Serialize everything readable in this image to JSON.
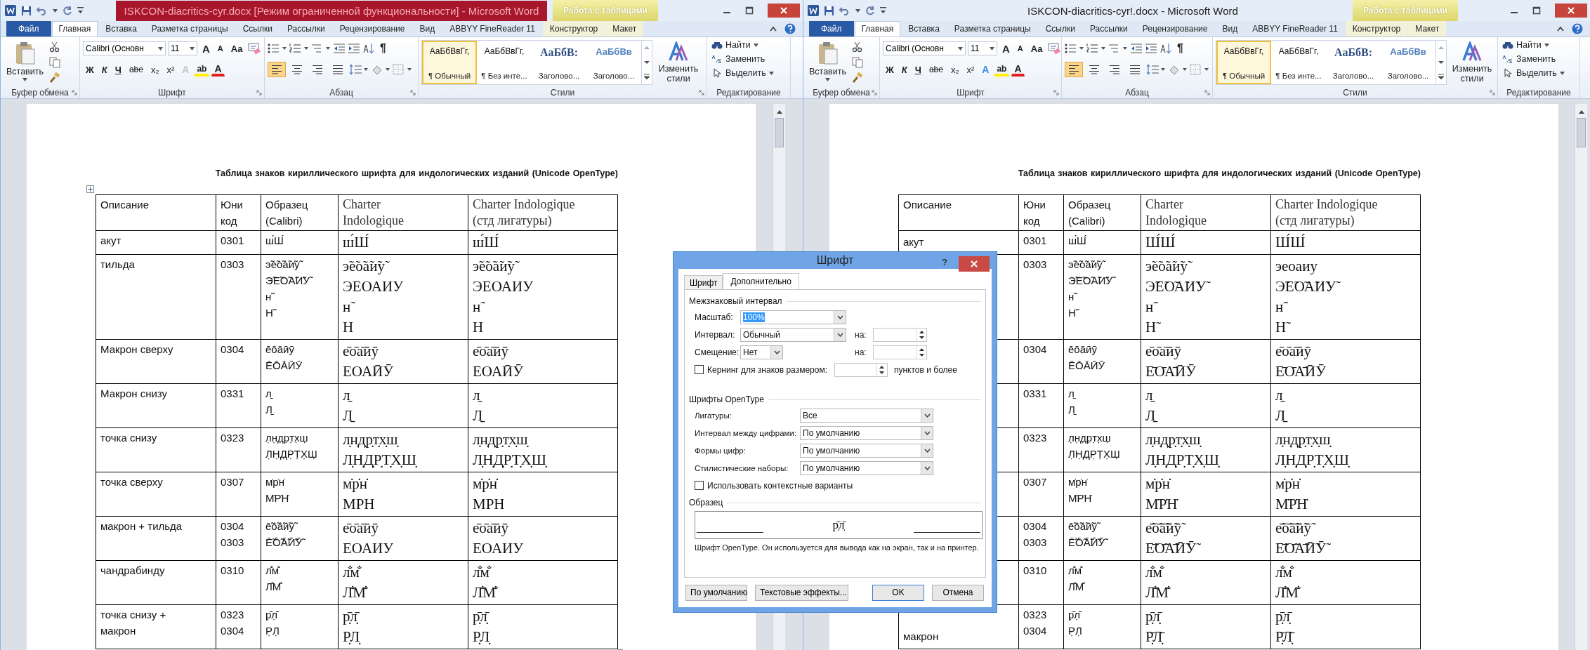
{
  "windows": [
    {
      "title": "ISKCON-diacritics-cyr.docx [Режим ограниченной функциональности] - Microsoft Word",
      "title_highlighted": true,
      "contextual_group": "Работа с таблицами",
      "tabs": [
        {
          "label": "Файл",
          "kind": "file",
          "selected": false
        },
        {
          "label": "Главная",
          "kind": "normal",
          "selected": true
        },
        {
          "label": "Вставка",
          "kind": "normal",
          "selected": false
        },
        {
          "label": "Разметка страницы",
          "kind": "normal",
          "selected": false
        },
        {
          "label": "Ссылки",
          "kind": "normal",
          "selected": false
        },
        {
          "label": "Рассылки",
          "kind": "normal",
          "selected": false
        },
        {
          "label": "Рецензирование",
          "kind": "normal",
          "selected": false
        },
        {
          "label": "Вид",
          "kind": "normal",
          "selected": false
        },
        {
          "label": "ABBYY FineReader 11",
          "kind": "normal",
          "selected": false
        },
        {
          "label": "Конструктор",
          "kind": "contextual",
          "selected": false
        },
        {
          "label": "Макет",
          "kind": "contextual",
          "selected": false
        }
      ],
      "ribbon": {
        "paste": "Вставить",
        "font_name": "Calibri (Основн",
        "font_size": "11",
        "font_tools": [
          {
            "label": "A",
            "kind": "grow"
          },
          {
            "label": "A",
            "kind": "shrink"
          },
          {
            "label": "Aa",
            "kind": "case"
          }
        ],
        "font_buttons": [
          {
            "label": "Ж",
            "kind": "bold"
          },
          {
            "label": "К",
            "kind": "italic"
          },
          {
            "label": "Ч",
            "kind": "underline"
          },
          {
            "label": "abe",
            "kind": "strike"
          },
          {
            "label": "x₂",
            "kind": "plain"
          },
          {
            "label": "x²",
            "kind": "plain"
          }
        ],
        "color_tools": [
          {
            "label": "A",
            "kind": "effects",
            "disabled": true
          },
          {
            "label": "ab",
            "kind": "highlight",
            "disabled": false
          },
          {
            "label": "A",
            "kind": "color",
            "disabled": false
          }
        ],
        "marks_button": "¶",
        "align_buttons": [
          {
            "kind": "left",
            "selected": true
          },
          {
            "kind": "center",
            "selected": false
          },
          {
            "kind": "right",
            "selected": false
          },
          {
            "kind": "justify",
            "selected": false
          }
        ],
        "styles": [
          {
            "sample": "АаБбВвГг,",
            "name": "¶ Обычный",
            "kind": "normal",
            "selected": true
          },
          {
            "sample": "АаБбВвГг,",
            "name": "¶ Без инте...",
            "kind": "plain",
            "selected": false
          },
          {
            "sample": "АаБбВ:",
            "name": "Заголово...",
            "kind": "heading1",
            "selected": false
          },
          {
            "sample": "АаБбВв",
            "name": "Заголово...",
            "kind": "heading2",
            "selected": false
          }
        ],
        "change_styles": "Изменить стили",
        "editing": [
          {
            "label": "Найти",
            "kind": "find"
          },
          {
            "label": "Заменить",
            "kind": "replace"
          },
          {
            "label": "Выделить",
            "kind": "select"
          }
        ],
        "group_labels": [
          "Буфер обмена",
          "Шрифт",
          "Абзац",
          "Стили",
          "Редактирование"
        ]
      },
      "document": {
        "heading": "Таблица знаков кириллического шрифта для индологических изданий (Unicode OpenType)",
        "table_handles": true,
        "columns": [
          {
            "label": "Описание",
            "kind": "sans"
          },
          {
            "label": "Юни\nкод",
            "kind": "sans"
          },
          {
            "label": "Образец\n(Calibri)",
            "kind": "sans"
          },
          {
            "label": "Charter\nIndologique",
            "kind": "serif"
          },
          {
            "label": "Charter Indologique\n(стд лигатуры)",
            "kind": "serif"
          }
        ],
        "rows": [
          {
            "cells": [
              "акут",
              "0301",
              "ш́Ш́",
              "ш́Ш́",
              "ш́Ш́"
            ]
          },
          {
            "cells": [
              "тильда",
              "0303",
              "э̃е̃о̃а̃и̃у̃\nЭ̃Е̃О̃А̃И̃У̃\nн̃\nН̃",
              "э̃е̃о̃а̃и̃у̃\nЭЕОАИУ\nн̃\nН",
              "э̃е̃о̃а̃и̃у̃\nЭЕОАИУ\nн̃\nН"
            ]
          },
          {
            "cells": [
              "Макрон сверху",
              "0304",
              "е̄о̄а̄ӣӯ\nЕ̄О̄А̄ӢӮ",
              "е̄о̄а̄ӣӯ\nЕОАӢӮ",
              "е̄о̄а̄ӣӯ\nЕОАӢӮ"
            ]
          },
          {
            "cells": [
              "Макрон снизу",
              "0331",
              "л̱\nЛ̱",
              "л̱\nЛ̱",
              "л̱\nЛ̱"
            ]
          },
          {
            "cells": [
              "точка снизу",
              "0323",
              "л̣н̣д̣р̣т̣х̣ш̣\nЛ̣Н̣Д̣Р̣Т̣Х̣Ш̣",
              "л̣н̣д̣р̣т̣х̣ш̣\nЛ̣Н̣Д̣Р̣Т̣Х̣Ш̣",
              "л̣н̣д̣р̣т̣х̣ш̣\nЛ̣Н̣Д̣Р̣Т̣Х̣Ш̣"
            ]
          },
          {
            "cells": [
              "точка сверху",
              "0307",
              "м̇р̇н̇\nМ̇Р̇Н̇",
              "м̇р̇н̇\nМРН",
              "м̇р̇н̇\nМРН"
            ]
          },
          {
            "cells": [
              "макрон + тильда",
              "0304\n0303",
              "е̄̃о̄̃а̄̃ӣ̃ӯ̃\nЕ̄̃О̄̃А̄̃Ӣ̃Ӯ̃",
              "е̄о̄а̄ӣӯ\nЕОАИУ",
              "е̄о̄а̄ӣӯ\nЕОАИУ"
            ]
          },
          {
            "cells": [
              "чандрабинду",
              "0310",
              "л̐м̐\nЛ̐М̐",
              "л̐м̐\nЛ̐М̐",
              "л̐м̐\nЛ̐М̐"
            ]
          },
          {
            "cells": [
              "точка снизу +\nмакрон",
              "0323\n0304",
              "р̣̄л̣̄\nР̣Л̣",
              "р̣̄л̣̄\nР̣Л̣",
              "р̣̄л̣̄\nР̣Л̣"
            ]
          }
        ]
      }
    },
    {
      "title": "ISKCON-diacritics-cyr!.docx - Microsoft Word",
      "title_highlighted": false,
      "contextual_group": "Работа с таблицами",
      "tabs": [
        {
          "label": "Файл",
          "kind": "file",
          "selected": false
        },
        {
          "label": "Главная",
          "kind": "normal",
          "selected": true
        },
        {
          "label": "Вставка",
          "kind": "normal",
          "selected": false
        },
        {
          "label": "Разметка страницы",
          "kind": "normal",
          "selected": false
        },
        {
          "label": "Ссылки",
          "kind": "normal",
          "selected": false
        },
        {
          "label": "Рассылки",
          "kind": "normal",
          "selected": false
        },
        {
          "label": "Рецензирование",
          "kind": "normal",
          "selected": false
        },
        {
          "label": "Вид",
          "kind": "normal",
          "selected": false
        },
        {
          "label": "ABBYY FineReader 11",
          "kind": "normal",
          "selected": false
        },
        {
          "label": "Конструктор",
          "kind": "contextual",
          "selected": false
        },
        {
          "label": "Макет",
          "kind": "contextual",
          "selected": false
        }
      ],
      "ribbon": {
        "paste": "Вставить",
        "font_name": "Calibri (Основн",
        "font_size": "11",
        "font_tools": [
          {
            "label": "A",
            "kind": "grow"
          },
          {
            "label": "A",
            "kind": "shrink"
          },
          {
            "label": "Aa",
            "kind": "case"
          }
        ],
        "font_buttons": [
          {
            "label": "Ж",
            "kind": "bold"
          },
          {
            "label": "К",
            "kind": "italic"
          },
          {
            "label": "Ч",
            "kind": "underline"
          },
          {
            "label": "abe",
            "kind": "strike"
          },
          {
            "label": "x₂",
            "kind": "plain"
          },
          {
            "label": "x²",
            "kind": "plain"
          }
        ],
        "color_tools": [
          {
            "label": "A",
            "kind": "effects",
            "disabled": false
          },
          {
            "label": "ab",
            "kind": "highlight",
            "disabled": false
          },
          {
            "label": "A",
            "kind": "color",
            "disabled": false
          }
        ],
        "marks_button": "¶",
        "align_buttons": [
          {
            "kind": "left",
            "selected": true
          },
          {
            "kind": "center",
            "selected": false
          },
          {
            "kind": "right",
            "selected": false
          },
          {
            "kind": "justify",
            "selected": false
          }
        ],
        "styles": [
          {
            "sample": "АаБбВвГг,",
            "name": "¶ Обычный",
            "kind": "normal",
            "selected": true
          },
          {
            "sample": "АаБбВвГг,",
            "name": "¶ Без инте...",
            "kind": "plain",
            "selected": false
          },
          {
            "sample": "АаБбВ:",
            "name": "Заголово...",
            "kind": "heading1",
            "selected": false
          },
          {
            "sample": "АаБбВв",
            "name": "Заголово...",
            "kind": "heading2",
            "selected": false
          }
        ],
        "change_styles": "Изменить стили",
        "editing": [
          {
            "label": "Найти",
            "kind": "find"
          },
          {
            "label": "Заменить",
            "kind": "replace"
          },
          {
            "label": "Выделить",
            "kind": "select"
          }
        ],
        "group_labels": [
          "Буфер обмена",
          "Шрифт",
          "Абзац",
          "Стили",
          "Редактирование"
        ]
      },
      "document": {
        "heading": "Таблица знаков кириллического шрифта для индологических изданий (Unicode OpenType)",
        "table_handles": false,
        "columns": [
          {
            "label": "Описание",
            "kind": "sans"
          },
          {
            "label": "Юни\nкод",
            "kind": "sans"
          },
          {
            "label": "Образец\n(Calibri)",
            "kind": "sans"
          },
          {
            "label": "Charter\nIndologique",
            "kind": "serif"
          },
          {
            "label": "Charter Indologique\n(стд лигатуры)",
            "kind": "serif"
          }
        ],
        "rows": [
          {
            "cells": [
              "акут",
              "0301",
              "ш́Ш́",
              "Ш́Ш́",
              "Ш́Ш́"
            ]
          },
          {
            "cells": [
              "",
              "0303",
              "э̃е̃о̃а̃и̃у̃\nЭ̃Е̃О̃А̃И̃У̃\nн̃\nН̃",
              "э̃е̃о̃а̃и̃у̃\nЭ̃Е̃О̃А̃И̃У̃\nн̃\nН̃",
              "эеоаиу\nЭ̃Е̃О̃А̃И̃У̃\nн̃\nН̃"
            ]
          },
          {
            "cells": [
              "",
              "0304",
              "е̄о̄а̄ӣӯ\nЕ̄О̄А̄ӢӮ",
              "е̄о̄а̄ӣӯ\nЕ̄О̄А̄ӢӮ",
              "е̄о̄а̄ӣӯ\nЕ̄О̄А̄ӢӮ"
            ]
          },
          {
            "cells": [
              "",
              "0331",
              "л̱\nЛ̱",
              "л̱\nЛ̱",
              "л̱\nЛ̱"
            ]
          },
          {
            "cells": [
              "",
              "0323",
              "л̣н̣д̣р̣т̣х̣ш̣\nЛ̣Н̣Д̣Р̣Т̣Х̣Ш̣",
              "л̣н̣д̣р̣т̣х̣ш̣\nЛ̣Н̣Д̣Р̣Т̣Х̣Ш̣",
              "л̣н̣д̣р̣т̣х̣ш̣\nЛ̣Н̣Д̣Р̣Т̣Х̣Ш̣"
            ]
          },
          {
            "cells": [
              "",
              "0307",
              "м̇р̇н̇\nМ̇Р̇Н̇",
              "м̇р̇н̇\nМ̇Р̇Н̇",
              "м̇р̇н̇\nМ̇Р̇Н̇"
            ]
          },
          {
            "cells": [
              "",
              "0304\n0303",
              "е̄̃о̄̃а̄̃ӣ̃ӯ̃\nЕ̄̃О̄̃А̄̃Ӣ̃Ӯ̃",
              "е̄̃о̄̃а̄̃ӣ̃ӯ̃\nЕ̄̃О̄̃А̄̃Ӣ̃Ӯ̃",
              "е̄̃о̄̃а̄̃ӣ̃ӯ̃\nЕ̄̃О̄̃А̄̃Ӣ̃Ӯ̃"
            ]
          },
          {
            "cells": [
              "",
              "0310",
              "л̐м̐\nЛ̐М̐",
              "л̐м̐\nЛ̐М̐",
              "л̐м̐\nЛ̐М̐"
            ]
          },
          {
            "cells": [
              "макрон",
              "0323\n0304",
              "р̣̄л̣̄\nР̣Л̣",
              "р̣̄л̣̄\nР̣̄Л̣̄",
              "р̣̄л̣̄\nР̣̄Л̣̄"
            ]
          }
        ]
      }
    }
  ],
  "dialog": {
    "title": "Шрифт",
    "help": "?",
    "tabs": [
      {
        "label": "Шрифт",
        "selected": false
      },
      {
        "label": "Дополнительно",
        "selected": true
      }
    ],
    "spacing": {
      "title": "Межзнаковый интервал",
      "scale": {
        "label": "Масштаб:",
        "value": "100%",
        "value_selected": true
      },
      "interval": {
        "label": "Интервал:",
        "value": "Обычный",
        "by_label": "на:"
      },
      "offset": {
        "label": "Смещение:",
        "value": "Нет",
        "by_label": "на:"
      },
      "kerning": {
        "label": "Кернинг для знаков размером:",
        "checked": false,
        "suffix": "пунктов и более"
      }
    },
    "opentype": {
      "title": "Шрифты OpenType",
      "rows": [
        {
          "label": "Лигатуры:",
          "value": "Все"
        },
        {
          "label": "Интервал между цифрами:",
          "value": "По умолчанию"
        },
        {
          "label": "Формы цифр:",
          "value": "По умолчанию"
        },
        {
          "label": "Стилистические наборы:",
          "value": "По умолчанию"
        }
      ],
      "contextual": {
        "label": "Использовать контекстные варианты",
        "checked": false
      }
    },
    "preview": {
      "title": "Образец",
      "sample": "р̣̄л̣̄",
      "note": "Шрифт OpenType. Он используется для вывода как на экран, так и на принтер."
    },
    "buttons": [
      {
        "label": "По умолчанию",
        "kind": "normal"
      },
      {
        "label": "Текстовые эффекты...",
        "kind": "normal"
      },
      {
        "label": "OK",
        "kind": "default"
      },
      {
        "label": "Отмена",
        "kind": "normal"
      }
    ]
  }
}
